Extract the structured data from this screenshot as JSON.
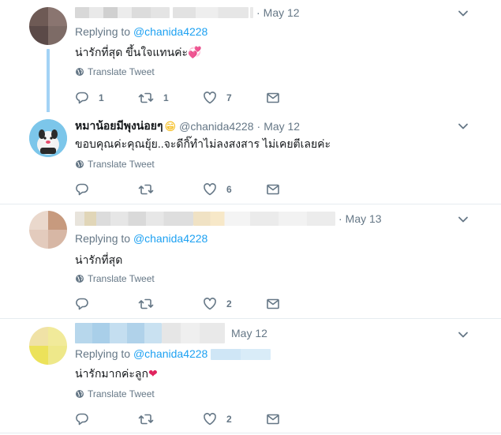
{
  "tweets": [
    {
      "timestamp": "May 12",
      "replying_prefix": "Replying to",
      "replying_to": "@chanida4228",
      "text": "น่ารักที่สุด ขึ้นใจแทนค่ะ",
      "translate": "Translate Tweet",
      "reply_count": "1",
      "retweet_count": "1",
      "like_count": "7"
    },
    {
      "name": "หมาน้อยมีพุงน่อยๆ",
      "handle": "@chanida4228",
      "timestamp": "May 12",
      "text": "ขอบคุณค่ะคุณยุ้ย..จะดีกิ๊ทำไม่ลงสงสาร ไม่เคยตีเลยค่ะ",
      "translate": "Translate Tweet",
      "reply_count": "",
      "retweet_count": "",
      "like_count": "6"
    },
    {
      "timestamp": "May 13",
      "replying_prefix": "Replying to",
      "replying_to": "@chanida4228",
      "text": "น่ารักที่สุด",
      "translate": "Translate Tweet",
      "reply_count": "",
      "retweet_count": "",
      "like_count": "2"
    },
    {
      "timestamp": "May 12",
      "replying_prefix": "Replying to",
      "replying_to": "@chanida4228",
      "text": "น่ารักมากค่ะลูก",
      "translate": "Translate Tweet",
      "reply_count": "",
      "retweet_count": "",
      "like_count": "2"
    }
  ],
  "icons": {
    "reply": "reply-icon",
    "retweet": "retweet-icon",
    "like": "heart-icon",
    "dm": "envelope-icon",
    "globe": "globe-icon",
    "chevron": "chevron-down-icon"
  },
  "colors": {
    "link": "#1da1f2",
    "muted": "#657786",
    "thread_line": "#a3d3f5",
    "heart_emoji": "#e0245e"
  }
}
